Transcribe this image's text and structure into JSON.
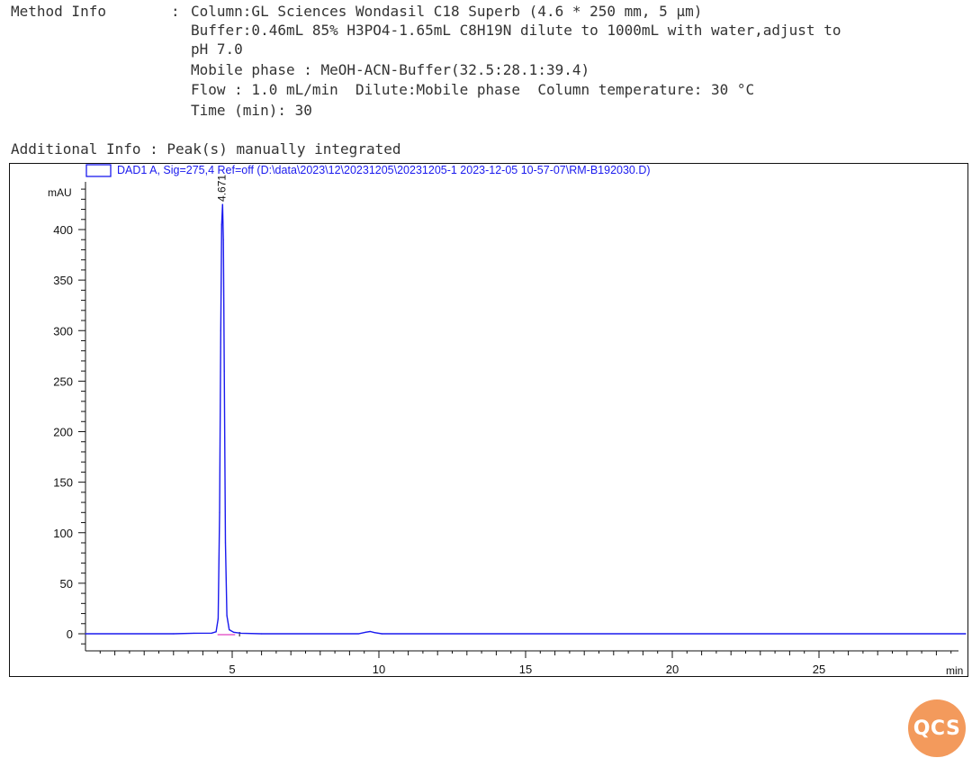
{
  "method_info": {
    "label": "Method Info",
    "sep": ":",
    "column": "Column:GL Sciences Wondasil C18 Superb (4.6 * 250 mm, 5 µm)",
    "buffer_line1": "Buffer:0.46mL 85% H3PO4-1.65mL C8H19N dilute to 1000mL with water,adjust to",
    "buffer_line2": "pH 7.0",
    "mobile_phase": "Mobile phase : MeOH-ACN-Buffer(32.5:28.1:39.4)",
    "flow_line": "Flow : 1.0 mL/min  Dilute:Mobile phase  Column temperature: 30 °C",
    "time_line": "Time (min): 30"
  },
  "additional_info": "Additional Info : Peak(s) manually integrated",
  "logo_text": "QCS",
  "chart_data": {
    "type": "line",
    "legend": "DAD1 A, Sig=275,4 Ref=off (D:\\data\\2023\\12\\20231205\\20231205-1 2023-12-05 10-57-07\\RM-B192030.D)",
    "ylabel": "mAU",
    "xlabel": "min",
    "xlim": [
      0,
      30
    ],
    "ylim": [
      -10,
      440
    ],
    "yticks": [
      0,
      50,
      100,
      150,
      200,
      250,
      300,
      350,
      400
    ],
    "xticks": [
      5,
      10,
      15,
      20,
      25
    ],
    "peak_label": "4.671",
    "colors": {
      "trace": "#1a1aee",
      "legend_box": "#1a1aee",
      "baseline_marker": "#e040c0",
      "axis": "#111111"
    },
    "series": [
      {
        "values": [
          {
            "x": 0.0,
            "y": 0
          },
          {
            "x": 3.0,
            "y": 0
          },
          {
            "x": 3.7,
            "y": 0.5
          },
          {
            "x": 4.3,
            "y": 0.6
          },
          {
            "x": 4.45,
            "y": 2
          },
          {
            "x": 4.52,
            "y": 15
          },
          {
            "x": 4.57,
            "y": 120
          },
          {
            "x": 4.61,
            "y": 300
          },
          {
            "x": 4.64,
            "y": 405
          },
          {
            "x": 4.671,
            "y": 425
          },
          {
            "x": 4.7,
            "y": 390
          },
          {
            "x": 4.73,
            "y": 260
          },
          {
            "x": 4.77,
            "y": 90
          },
          {
            "x": 4.82,
            "y": 18
          },
          {
            "x": 4.9,
            "y": 4
          },
          {
            "x": 5.05,
            "y": 1.5
          },
          {
            "x": 5.3,
            "y": 0.5
          },
          {
            "x": 6.0,
            "y": 0
          },
          {
            "x": 9.3,
            "y": 0
          },
          {
            "x": 9.55,
            "y": 1.5
          },
          {
            "x": 9.7,
            "y": 2.2
          },
          {
            "x": 9.85,
            "y": 1.2
          },
          {
            "x": 10.1,
            "y": 0
          },
          {
            "x": 30.0,
            "y": 0
          }
        ]
      }
    ]
  }
}
